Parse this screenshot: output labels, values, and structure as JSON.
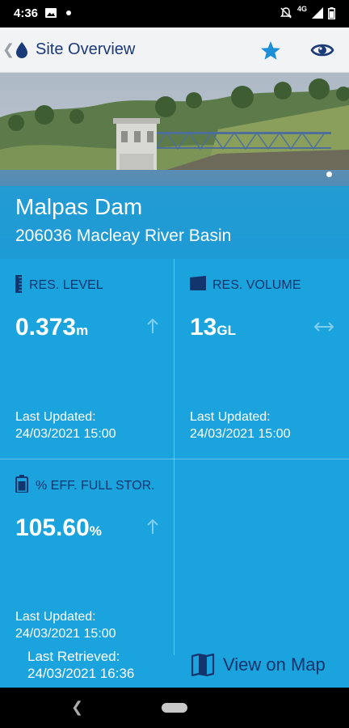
{
  "status_bar": {
    "time": "4:36",
    "network": "4G"
  },
  "app_bar": {
    "title": "Site Overview"
  },
  "site": {
    "name": "Malpas Dam",
    "subtitle": "206036 Macleay River Basin"
  },
  "tiles": [
    {
      "label": "RES. LEVEL",
      "value": "0.373",
      "unit": "m",
      "trend": "up",
      "updated_label": "Last Updated:",
      "updated_time": "24/03/2021 15:00",
      "icon": "ruler-icon"
    },
    {
      "label": "RES. VOLUME",
      "value": "13",
      "unit": "GL",
      "trend": "steady",
      "updated_label": "Last Updated:",
      "updated_time": "24/03/2021 15:00",
      "icon": "volume-icon"
    },
    {
      "label": "% EFF. FULL STOR.",
      "value": "105.60",
      "unit": "%",
      "trend": "up",
      "updated_label": "Last Updated:",
      "updated_time": "24/03/2021 15:00",
      "icon": "battery-icon"
    }
  ],
  "footer": {
    "retrieved_label": "Last Retrieved:",
    "retrieved_time": "24/03/2021 16:36",
    "map_label": "View on Map"
  },
  "colors": {
    "tile_bg": "#1ba3dd",
    "label_text": "#13356e",
    "app_bar_bg": "#f2f3f5",
    "accent": "#1d8fd6"
  }
}
